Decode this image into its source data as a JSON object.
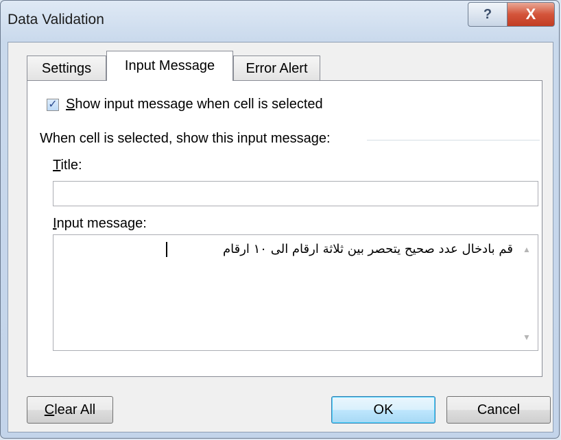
{
  "window": {
    "title": "Data Validation",
    "help_label": "?",
    "close_label": "X"
  },
  "tabs": [
    {
      "label": "Settings",
      "active": false
    },
    {
      "label": "Input Message",
      "active": true
    },
    {
      "label": "Error Alert",
      "active": false
    }
  ],
  "input_message": {
    "show_checkbox": {
      "checked": true,
      "mnemonic": "S",
      "label_rest": "how input message when cell is selected"
    },
    "group_label": "When cell is selected, show this input message:",
    "title_label": {
      "mnemonic": "T",
      "rest": "itle:"
    },
    "title_value": "",
    "message_label": {
      "mnemonic": "I",
      "rest": "nput message:"
    },
    "message_value": "قم بادخال عدد صحيح يتحصر بين ثلاثة ارقام الى ١٠ ارقام"
  },
  "buttons": {
    "clear_all": {
      "mnemonic": "C",
      "rest": "lear All"
    },
    "ok": "OK",
    "cancel": "Cancel"
  },
  "colors": {
    "close_button": "#c13d24",
    "ok_border": "#3c7fb1",
    "checkbox_check": "#2d4d8f"
  }
}
